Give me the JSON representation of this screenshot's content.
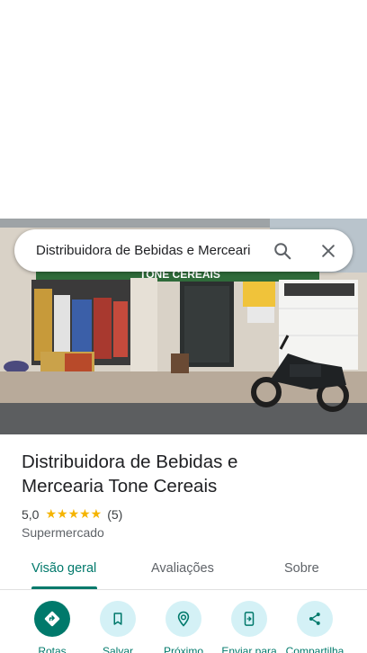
{
  "search": {
    "query": "Distribuidora de Bebidas e Merceari"
  },
  "place": {
    "title_line1": "Distribuidora de Bebidas e",
    "title_line2": "Mercearia Tone Cereais",
    "rating": "5,0",
    "stars": "★★★★★",
    "review_count": "(5)",
    "category": "Supermercado",
    "star_color": "#f5b400"
  },
  "photo": {
    "sign_text": "TONE CEREAIS"
  },
  "tabs": [
    {
      "label": "Visão geral",
      "active": true
    },
    {
      "label": "Avaliações",
      "active": false
    },
    {
      "label": "Sobre",
      "active": false
    }
  ],
  "actions": [
    {
      "label": "Rotas",
      "icon": "directions-icon"
    },
    {
      "label": "Salvar",
      "icon": "bookmark-icon"
    },
    {
      "label": "Próximo",
      "icon": "nearby-icon"
    },
    {
      "label": "Enviar para",
      "icon": "send-to-phone-icon"
    },
    {
      "label": "Compartilha",
      "icon": "share-icon"
    }
  ],
  "colors": {
    "accent": "#00796b",
    "chip_bg": "#d4f1f6"
  }
}
